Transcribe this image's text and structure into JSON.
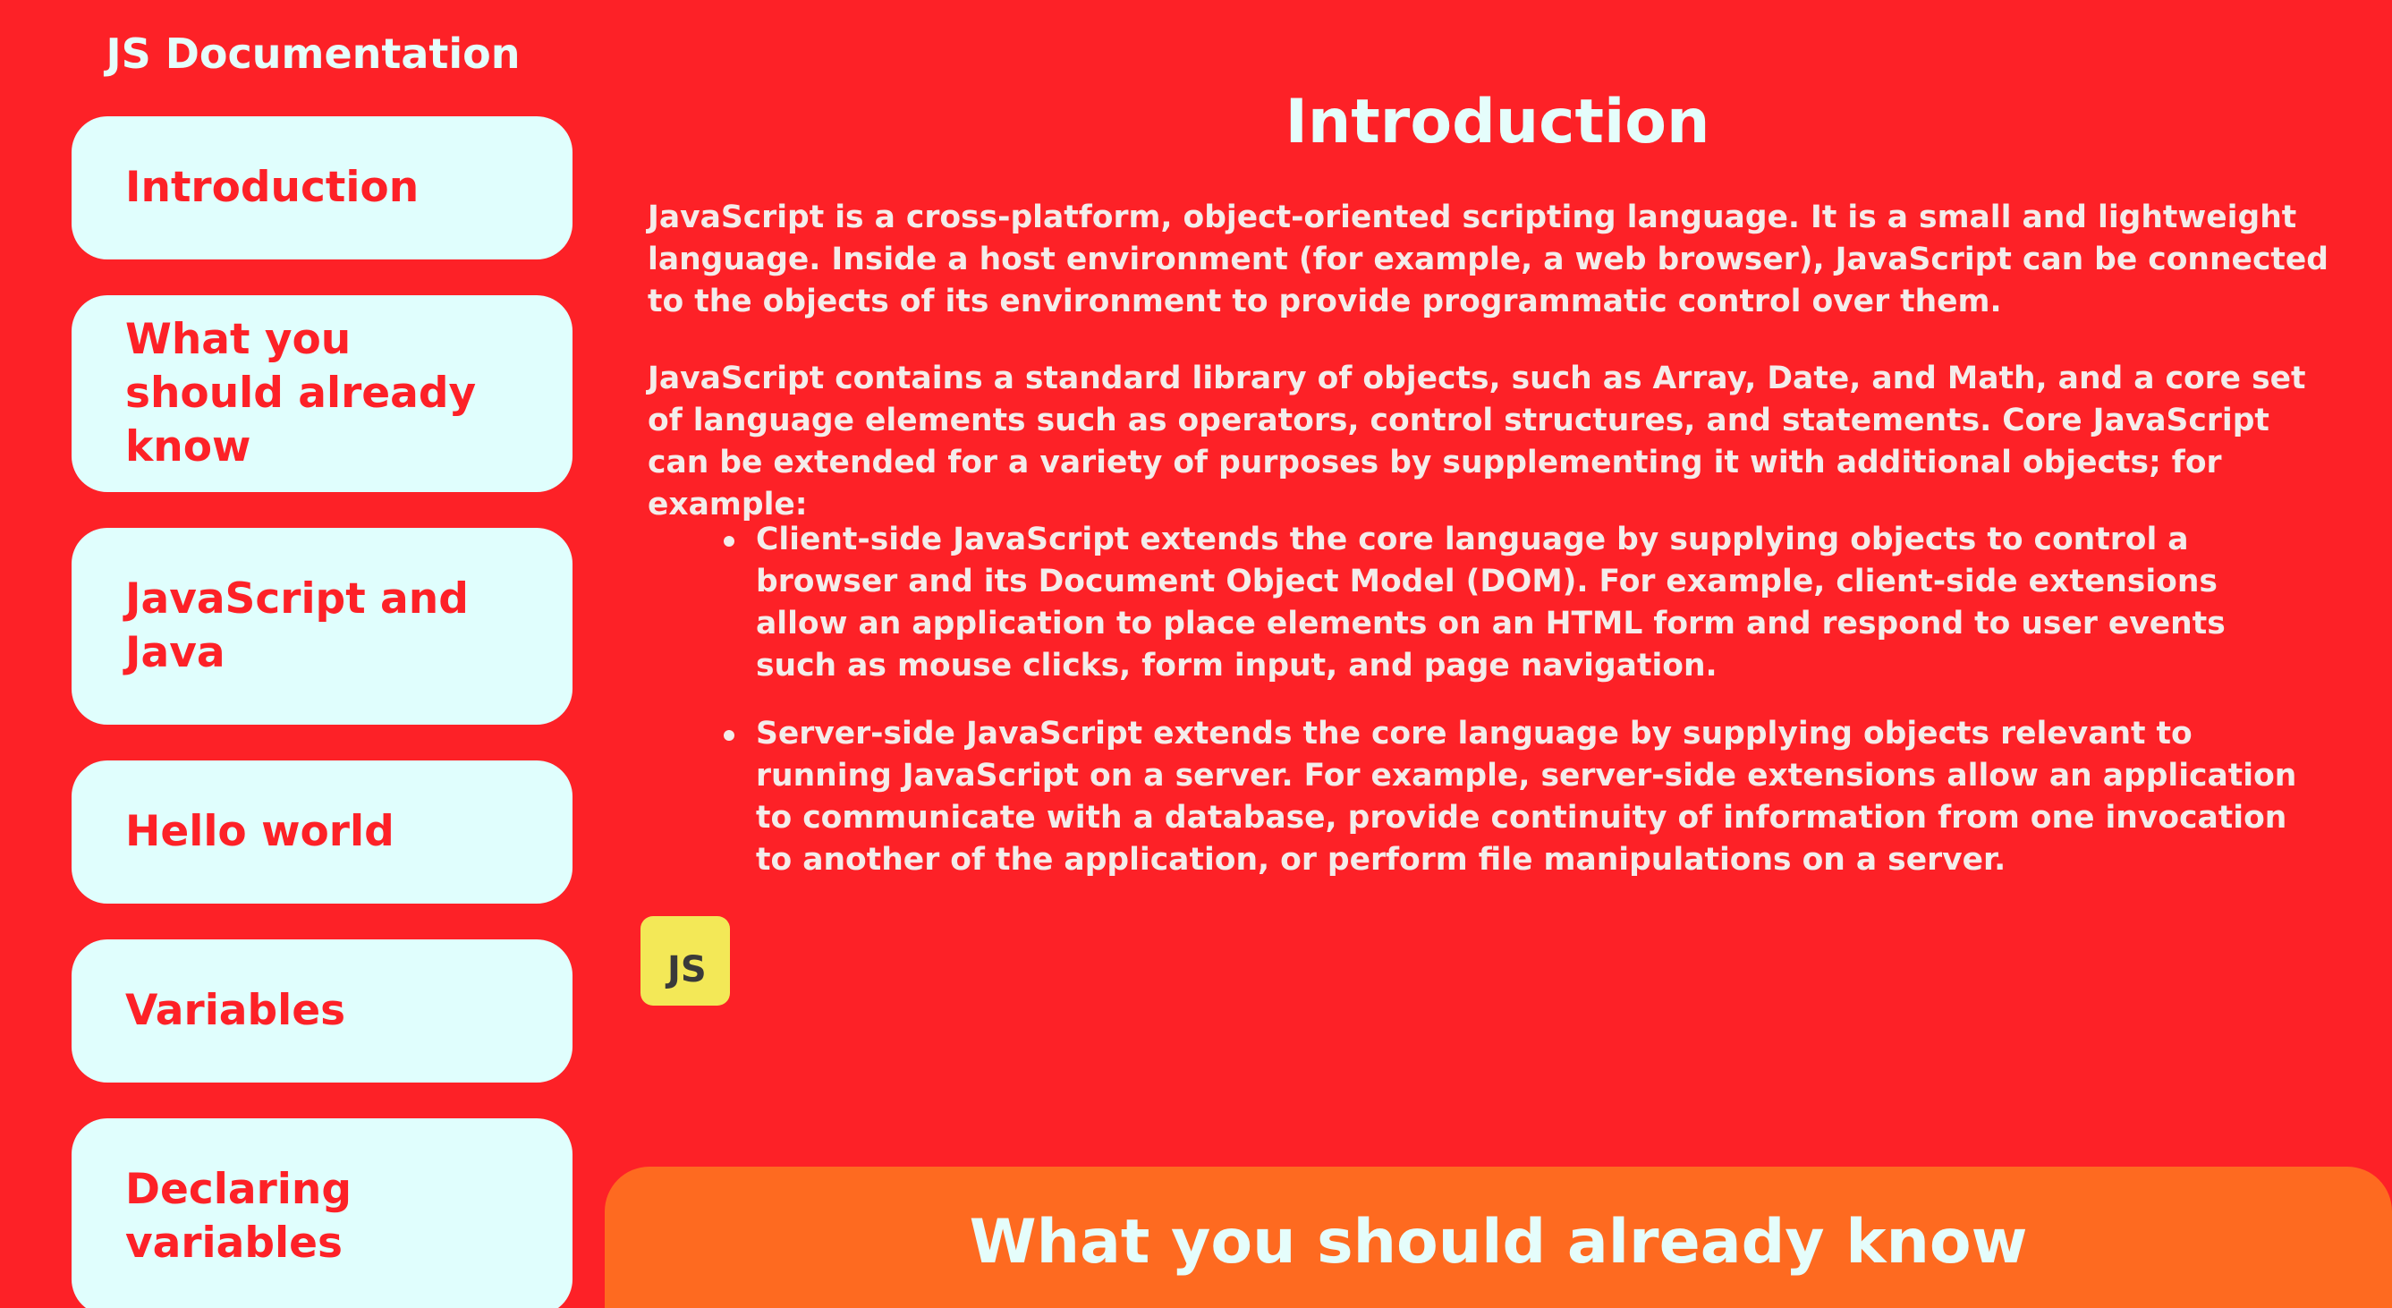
{
  "nav": {
    "title": "JS Documentation",
    "links": [
      "Introduction",
      "What you should already know",
      "JavaScript and Java",
      "Hello world",
      "Variables",
      "Declaring variables"
    ]
  },
  "main": {
    "heading": "Introduction",
    "paragraphs": [
      "JavaScript is a cross-platform, object-oriented scripting language. It is a small and lightweight language. Inside a host environment (for example, a web browser), JavaScript can be connected to the objects of its environment to provide programmatic control over them.",
      "JavaScript contains a standard library of objects, such as Array, Date, and Math, and a core set of language elements such as operators, control structures, and statements. Core JavaScript can be extended for a variety of purposes by supplementing it with additional objects; for example:"
    ],
    "bullets": [
      "Client-side JavaScript extends the core language by supplying objects to control a browser and its Document Object Model (DOM). For example, client-side extensions allow an application to place elements on an HTML form and respond to user events such as mouse clicks, form input, and page navigation.",
      "Server-side JavaScript extends the core language by supplying objects relevant to running JavaScript on a server. For example, server-side extensions allow an application to communicate with a database, provide continuity of information from one invocation to another of the application, or perform file manipulations on a server."
    ],
    "logo_text": "JS",
    "next_heading": "What you should already know"
  },
  "colors": {
    "background": "#fd2127",
    "nav_button_bg": "#e0fefd",
    "accent_text": "#fd2127",
    "heading_text": "#e5fdfb",
    "body_text": "#f4ecea",
    "logo_bg": "#f3e857",
    "next_section_bg": "#fe6a20"
  }
}
